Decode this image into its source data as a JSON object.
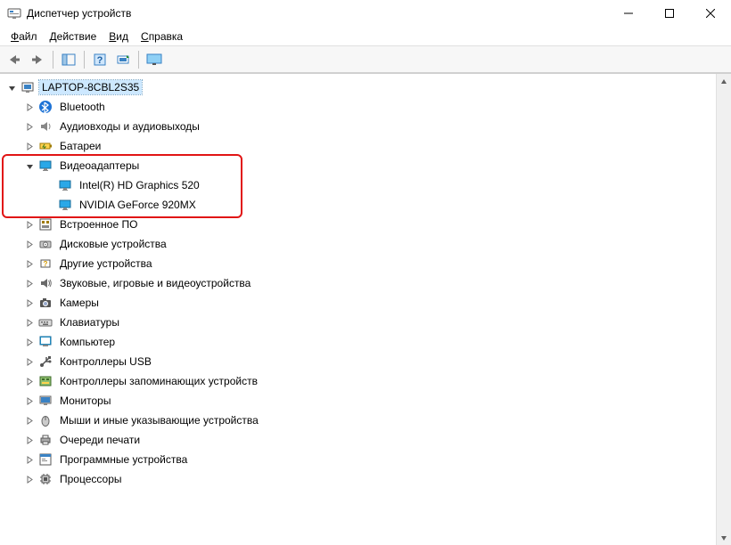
{
  "window": {
    "title": "Диспетчер устройств"
  },
  "menu": {
    "file": "Файл",
    "action": "Действие",
    "view": "Вид",
    "help": "Справка"
  },
  "tree": {
    "root": "LAPTOP-8CBL2S35",
    "items": [
      {
        "label": "Bluetooth",
        "icon": "bluetooth"
      },
      {
        "label": "Аудиовходы и аудиовыходы",
        "icon": "audio"
      },
      {
        "label": "Батареи",
        "icon": "battery"
      },
      {
        "label": "Видеоадаптеры",
        "icon": "display",
        "expanded": true,
        "children": [
          {
            "label": "Intel(R) HD Graphics 520",
            "icon": "display"
          },
          {
            "label": "NVIDIA GeForce 920MX",
            "icon": "display"
          }
        ]
      },
      {
        "label": "Встроенное ПО",
        "icon": "firmware"
      },
      {
        "label": "Дисковые устройства",
        "icon": "disk"
      },
      {
        "label": "Другие устройства",
        "icon": "other"
      },
      {
        "label": "Звуковые, игровые и видеоустройства",
        "icon": "sound"
      },
      {
        "label": "Камеры",
        "icon": "camera"
      },
      {
        "label": "Клавиатуры",
        "icon": "keyboard"
      },
      {
        "label": "Компьютер",
        "icon": "computer"
      },
      {
        "label": "Контроллеры USB",
        "icon": "usb"
      },
      {
        "label": "Контроллеры запоминающих устройств",
        "icon": "storagectrl"
      },
      {
        "label": "Мониторы",
        "icon": "monitor"
      },
      {
        "label": "Мыши и иные указывающие устройства",
        "icon": "mouse"
      },
      {
        "label": "Очереди печати",
        "icon": "printer"
      },
      {
        "label": "Программные устройства",
        "icon": "software"
      },
      {
        "label": "Процессоры",
        "icon": "cpu"
      }
    ]
  }
}
